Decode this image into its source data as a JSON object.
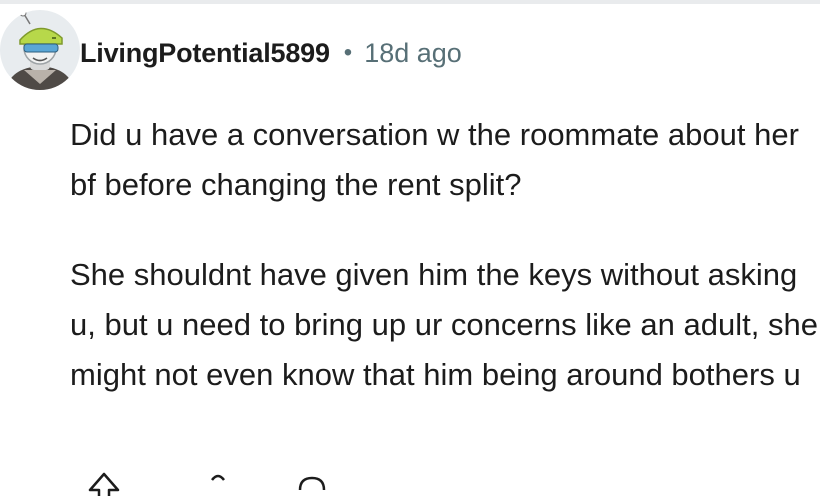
{
  "comment": {
    "author": "LivingPotential5899",
    "separator": "•",
    "timestamp": "18d ago",
    "paragraphs": [
      "Did u have a conversation w the roommate about her bf before changing the rent split?",
      "She shouldnt have given him the keys without asking u, but u need to bring up ur concerns like an adult, she might not even know that him being around bothers u"
    ]
  },
  "icons": {
    "avatar": "avatar-icon",
    "upvote": "upvote-icon",
    "downvote": "downvote-icon",
    "reply": "reply-icon"
  },
  "colors": {
    "text": "#1c1c1c",
    "muted": "#576f76",
    "avatar_accent": "#b7d84a"
  }
}
